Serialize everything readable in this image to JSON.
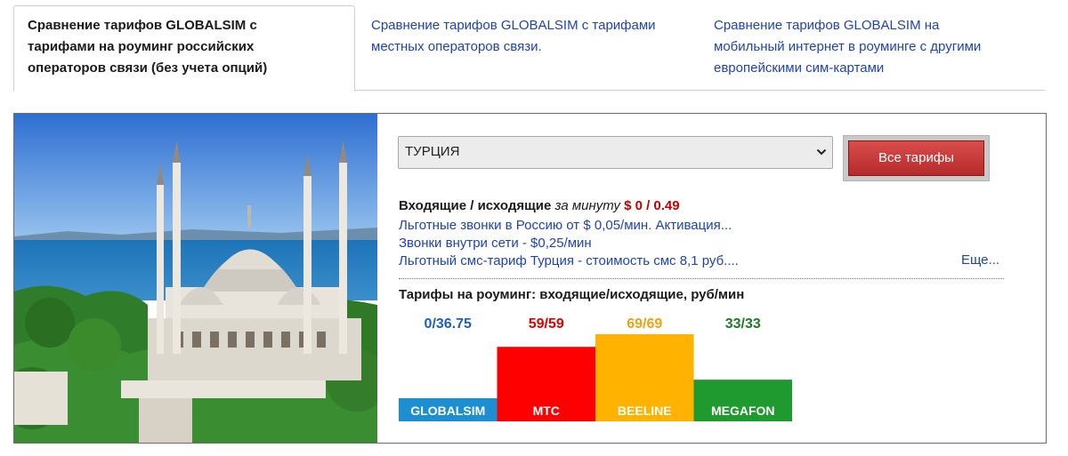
{
  "tabs": [
    {
      "label": "Сравнение тарифов GLOBALSIM с тарифами на роуминг российских операторов связи (без учета опций)",
      "lines": [
        "Сравнение тарифов GLOBALSIM с",
        "тарифами на роуминг российских",
        "операторов связи (без учета опций)"
      ],
      "active": true
    },
    {
      "label": "Сравнение тарифов GLOBALSIM с тарифами местных операторов связи.",
      "lines": [
        "Сравнение тарифов GLOBALSIM с тарифами",
        "местных операторов связи."
      ],
      "active": false
    },
    {
      "label": "Сравнение тарифов GLOBALSIM на мобильный интернет в роуминге с другими европейскими сим-картами",
      "lines": [
        "Сравнение тарифов GLOBALSIM на",
        "мобильный интернет в роуминге с другими",
        "европейскими сим-картами"
      ],
      "active": false
    }
  ],
  "country_select": {
    "value": "ТУРЦИЯ"
  },
  "all_tariffs_button": {
    "label": "Все тарифы"
  },
  "rates": {
    "label": "Входящие / исходящие",
    "per_minute": "за минуту",
    "price": "$ 0 / 0.49"
  },
  "info_links": [
    "Льготные звонки в Россию от $ 0,05/мин. Активация...",
    "Звонки внутри сети - $0,25/мин",
    "Льготный смс-тариф Турция - стоимость смс 8,1 руб...."
  ],
  "more_link": "Еще...",
  "colors": {
    "globalsim": "#1d8ed0",
    "mts": "#ff0000",
    "beeline": "#ffb300",
    "megafon": "#1f9a2e",
    "value_globalsim": "#1f5fb8",
    "value_mts": "#e00000",
    "value_beeline": "#f0a010",
    "value_megafon": "#1f7a2a"
  },
  "chart_data": {
    "type": "bar",
    "title": "Тарифы на роуминг: входящие/исходящие, руб/мин",
    "categories": [
      "GLOBALSIM",
      "MTC",
      "BEELINE",
      "MEGAFON"
    ],
    "value_labels": [
      "0/36.75",
      "59/59",
      "69/69",
      "33/33"
    ],
    "values": [
      36.75,
      59,
      69,
      33
    ],
    "ylim": [
      0,
      69
    ]
  }
}
